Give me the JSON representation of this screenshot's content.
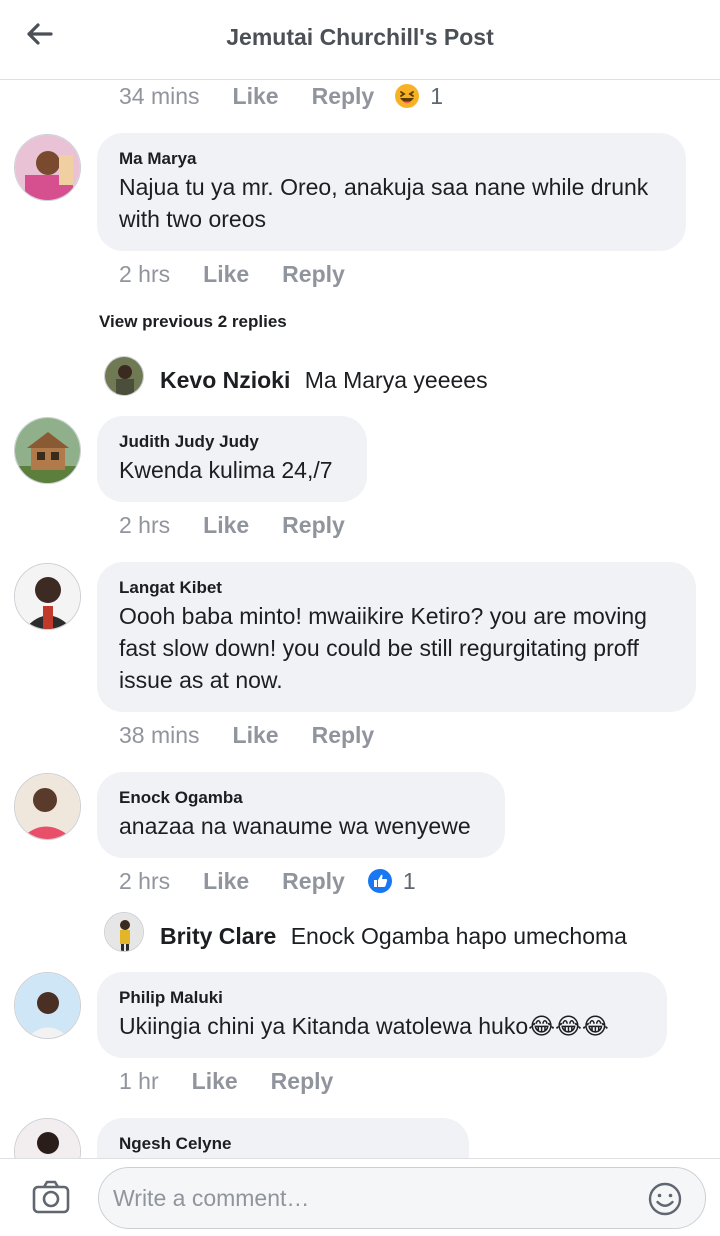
{
  "header": {
    "title": "Jemutai Churchill's Post"
  },
  "top_actions": {
    "time": "34 mins",
    "like": "Like",
    "reply": "Reply",
    "reaction_count": "1"
  },
  "comments": [
    {
      "name": "Ma Marya",
      "text": "Najua tu ya mr. Oreo, anakuja saa nane while drunk with two oreos",
      "time": "2 hrs",
      "like": "Like",
      "reply": "Reply"
    },
    {
      "name": "Judith Judy Judy",
      "text": "Kwenda kulima 24,/7",
      "time": "2 hrs",
      "like": "Like",
      "reply": "Reply"
    },
    {
      "name": "Langat Kibet",
      "text": "Oooh baba minto! mwaiikire Ketiro? you are moving fast slow down! you could be still regurgitating proff issue as at now.",
      "time": "38 mins",
      "like": "Like",
      "reply": "Reply"
    },
    {
      "name": "Enock Ogamba",
      "text": "anazaa na wanaume wa wenyewe",
      "time": "2 hrs",
      "like": "Like",
      "reply": "Reply",
      "reaction_count": "1"
    },
    {
      "name": "Philip Maluki",
      "text": "Ukiingia chini ya Kitanda watolewa huko😂😂😂",
      "time": "1 hr",
      "like": "Like",
      "reply": "Reply"
    },
    {
      "name": "Ngesh Celyne"
    }
  ],
  "view_previous": "View previous 2 replies",
  "replies": [
    {
      "name": "Kevo Nzioki",
      "text": "Ma Marya yeeees"
    },
    {
      "name": "Brity Clare",
      "text": "Enock Ogamba hapo umechoma"
    }
  ],
  "composer": {
    "placeholder": "Write a comment…"
  },
  "icons": {
    "back": "arrow-left-icon",
    "camera": "camera-icon",
    "emoji": "smiley-icon",
    "like_reaction": "like-reaction-icon",
    "haha_reaction": "haha-reaction-icon"
  },
  "colors": {
    "bubble": "#f0f2f5",
    "meta_text": "#90949c",
    "like_blue": "#1877f2",
    "haha_yellow": "#f7b125"
  }
}
